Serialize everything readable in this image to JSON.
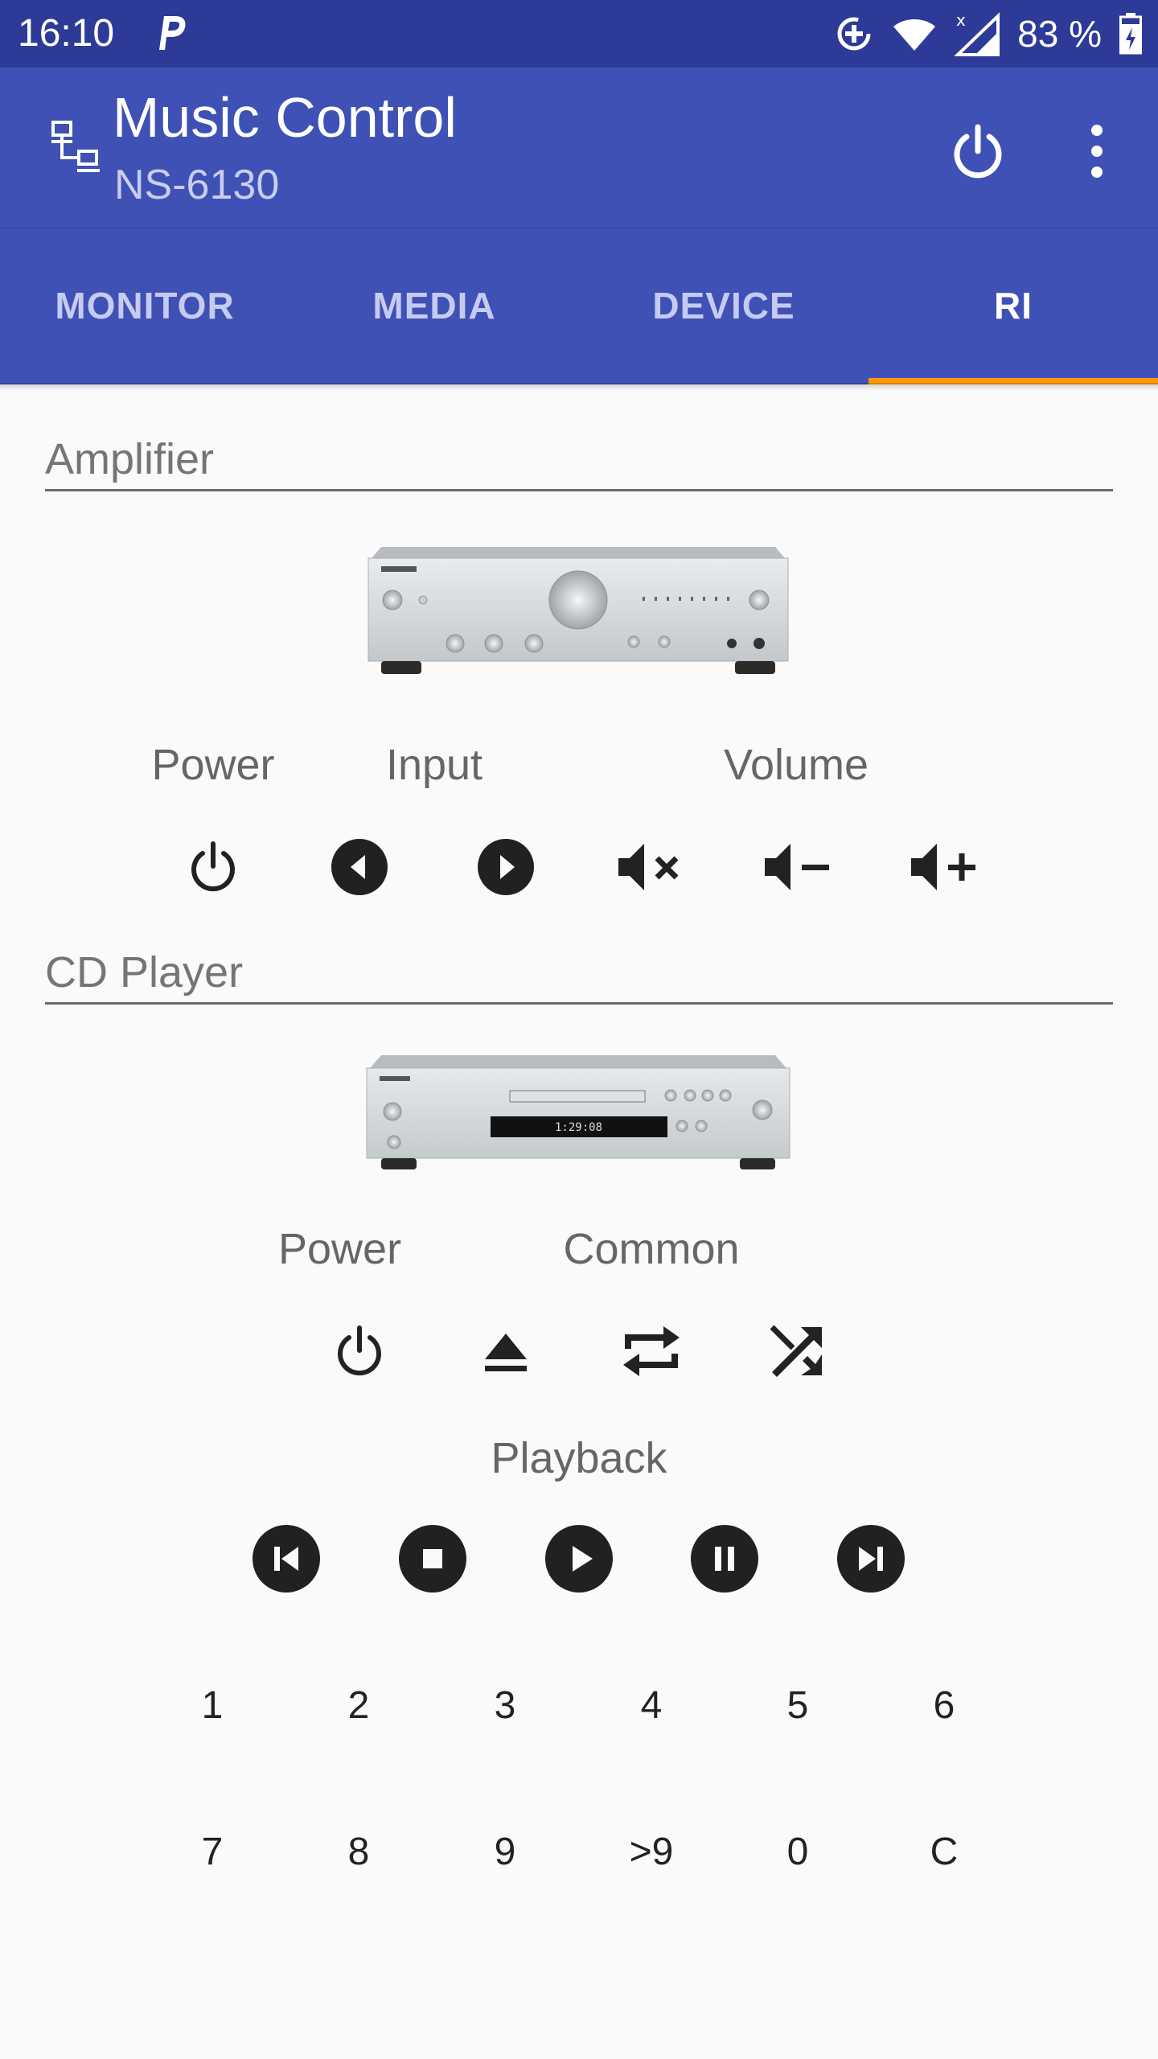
{
  "status_bar": {
    "time": "16:10",
    "battery": "83 %"
  },
  "app_bar": {
    "title": "Music Control",
    "subtitle": "NS-6130"
  },
  "tabs": [
    {
      "label": "MONITOR",
      "active": false
    },
    {
      "label": "MEDIA",
      "active": false
    },
    {
      "label": "DEVICE",
      "active": false
    },
    {
      "label": "RI",
      "active": true
    }
  ],
  "amplifier": {
    "title": "Amplifier",
    "labels": {
      "power": "Power",
      "input": "Input",
      "volume": "Volume"
    },
    "buttons": [
      "power-icon",
      "input-previous-icon",
      "input-next-icon",
      "mute-icon",
      "volume-down-icon",
      "volume-up-icon"
    ]
  },
  "cd_player": {
    "title": "CD Player",
    "labels": {
      "power": "Power",
      "common": "Common",
      "playback": "Playback"
    },
    "common_buttons": [
      "power-icon",
      "eject-icon",
      "repeat-icon",
      "shuffle-icon"
    ],
    "playback_buttons": [
      "skip-previous-icon",
      "stop-icon",
      "play-icon",
      "pause-icon",
      "skip-next-icon"
    ],
    "keypad_row1": [
      "1",
      "2",
      "3",
      "4",
      "5",
      "6"
    ],
    "keypad_row2": [
      "7",
      "8",
      "9",
      ">9",
      "0",
      "C"
    ]
  },
  "colors": {
    "primary": "#3f51b5",
    "primary_dark": "#2d3a97",
    "accent": "#ff9800",
    "background": "#fafafa"
  }
}
